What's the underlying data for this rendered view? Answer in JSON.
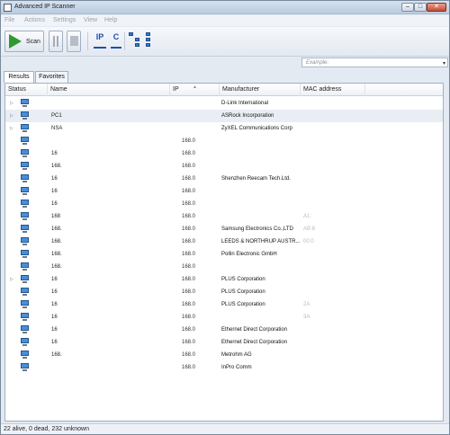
{
  "window": {
    "title": "Advanced IP Scanner",
    "min": "–",
    "max": "□",
    "close": "✕"
  },
  "menu": [
    "File",
    "Actions",
    "Settings",
    "View",
    "Help"
  ],
  "toolbar": {
    "scan_label": "Scan",
    "ip_label": "IP",
    "c_label": "C"
  },
  "search": {
    "placeholder": "Example:",
    "dropdown": "▾"
  },
  "tabs": [
    "Results",
    "Favorites"
  ],
  "columns": [
    "Status",
    "Name",
    "IP",
    "Manufacturer",
    "MAC address"
  ],
  "rows": [
    {
      "expander": "▷",
      "name": "",
      "ip": "",
      "manufacturer": "D-Link International",
      "mac": ""
    },
    {
      "expander": "▷",
      "name": "PC1",
      "ip": "",
      "manufacturer": "ASRock Incorporation",
      "mac": ""
    },
    {
      "expander": "▷",
      "name": "NSA",
      "ip": "",
      "manufacturer": "ZyXEL Communications Corp",
      "mac": ""
    },
    {
      "expander": "",
      "name": "",
      "ip": "168.0",
      "manufacturer": "",
      "mac": ""
    },
    {
      "expander": "",
      "name": "16",
      "ip": "168.0",
      "manufacturer": "",
      "mac": ""
    },
    {
      "expander": "",
      "name": "168.",
      "ip": "168.0",
      "manufacturer": "",
      "mac": ""
    },
    {
      "expander": "",
      "name": "16",
      "ip": "168.0",
      "manufacturer": "Shenzhen Reecam Tech.Ltd.",
      "mac": ""
    },
    {
      "expander": "",
      "name": "16",
      "ip": "168.0",
      "manufacturer": "",
      "mac": ""
    },
    {
      "expander": "",
      "name": "16",
      "ip": "168.0",
      "manufacturer": "",
      "mac": ""
    },
    {
      "expander": "",
      "name": "168",
      "ip": "168.0",
      "manufacturer": "",
      "mac": "A1:"
    },
    {
      "expander": "",
      "name": "168.",
      "ip": "168.0",
      "manufacturer": "Samsung Electronics Co.,LTD",
      "mac": "AB:8"
    },
    {
      "expander": "",
      "name": "168.",
      "ip": "168.0",
      "manufacturer": "LEEDS & NORTHRUP AUSTR...",
      "mac": "00:0"
    },
    {
      "expander": "",
      "name": "168.",
      "ip": "168.0",
      "manufacturer": "Pollin Electronic GmbH",
      "mac": ""
    },
    {
      "expander": "",
      "name": "168.",
      "ip": "168.0",
      "manufacturer": "",
      "mac": ""
    },
    {
      "expander": "▷",
      "name": "16",
      "ip": "168.0",
      "manufacturer": "PLUS  Corporation",
      "mac": ""
    },
    {
      "expander": "",
      "name": "16",
      "ip": "168.0",
      "manufacturer": "PLUS  Corporation",
      "mac": ""
    },
    {
      "expander": "",
      "name": "16",
      "ip": "168.0",
      "manufacturer": "PLUS  Corporation",
      "mac": "2A"
    },
    {
      "expander": "",
      "name": "16",
      "ip": "168.0",
      "manufacturer": "",
      "mac": "3A"
    },
    {
      "expander": "",
      "name": "16",
      "ip": "168.0",
      "manufacturer": "Ethernet Direct Corporation",
      "mac": ""
    },
    {
      "expander": "",
      "name": "16",
      "ip": "168.0",
      "manufacturer": "Ethernet Direct Corporation",
      "mac": ""
    },
    {
      "expander": "",
      "name": "168.",
      "ip": "168.0",
      "manufacturer": "Metrohm AG",
      "mac": ""
    },
    {
      "expander": "",
      "name": "",
      "ip": "168.0",
      "manufacturer": "InPro Comm",
      "mac": ""
    }
  ],
  "status": "22 alive, 0 dead, 232 unknown",
  "colors": {
    "accent": "#1f4fb0",
    "scan_green": "#2e9a2e",
    "chrome": "#e4eaf2"
  }
}
